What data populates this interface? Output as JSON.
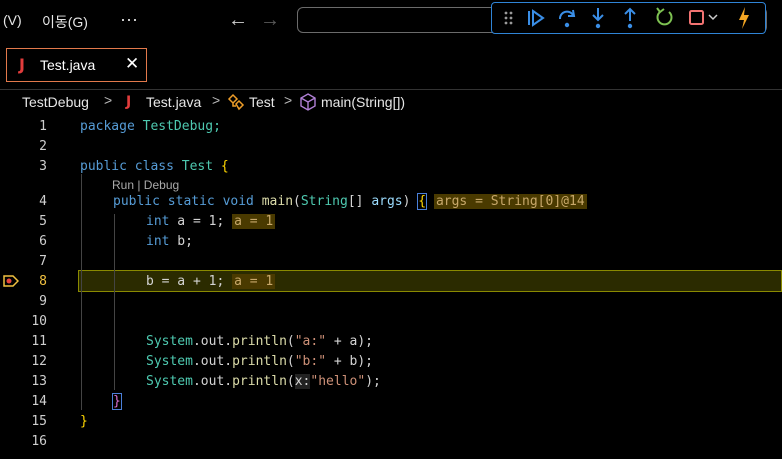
{
  "menu": {
    "view_label": "(V)",
    "go_label": "이동(G)",
    "more_label": "···"
  },
  "nav": {
    "back_glyph": "←",
    "forward_glyph": "→"
  },
  "debug_toolbar": {
    "icons": [
      "grip-icon",
      "continue-icon",
      "step-over-icon",
      "step-into-icon",
      "step-out-icon",
      "restart-icon",
      "stop-icon",
      "hot-reload-icon"
    ],
    "accent": "#3a8ee6"
  },
  "tabs": [
    {
      "icon_glyph": "J",
      "label": "Test.java",
      "close_glyph": "✕"
    }
  ],
  "breadcrumb": {
    "package": "TestDebug",
    "file": "Test.java",
    "file_icon_glyph": "J",
    "class": "Test",
    "method": "main(String[])",
    "separator": ">"
  },
  "editor": {
    "current_line": 8,
    "code_lens": "Run | Debug",
    "line_numbers": [
      "1",
      "2",
      "3",
      "4",
      "5",
      "6",
      "7",
      "8",
      "9",
      "10",
      "11",
      "12",
      "13",
      "14",
      "15",
      "16"
    ],
    "lines": {
      "l1_kw": "package",
      "l1_rest": " TestDebug;",
      "l3_kw": "public class",
      "l3_name": " Test ",
      "l3_brace": "{",
      "l4_kw": "public static void",
      "l4_fn": " main",
      "l4_p1": "(",
      "l4_type": "String",
      "l4_p2": "[] ",
      "l4_arg": "args",
      "l4_p3": ") ",
      "l4_brace": "{",
      "l4_inline": "args = String[0]@14",
      "l5_kw": "int",
      "l5_rest": " a = 1;",
      "l5_inline": "a = 1",
      "l6_kw": "int",
      "l6_rest": " b;",
      "l8_code": "b = a + 1;",
      "l8_inline": "a = 1",
      "l11_obj": "System",
      "l11_mid": ".out.",
      "l11_fn": "println",
      "l11_open": "(",
      "l11_str": "\"a:\"",
      "l11_rest": " + a);",
      "l12_obj": "System",
      "l12_mid": ".out.",
      "l12_fn": "println",
      "l12_open": "(",
      "l12_str": "\"b:\"",
      "l12_rest": " + b);",
      "l13_obj": "System",
      "l13_mid": ".out.",
      "l13_fn": "println",
      "l13_open": "(",
      "l13_hint": "x:",
      "l13_str": "\"hello\"",
      "l13_rest": ");",
      "l14_brace": "}",
      "l15_brace": "}"
    }
  }
}
